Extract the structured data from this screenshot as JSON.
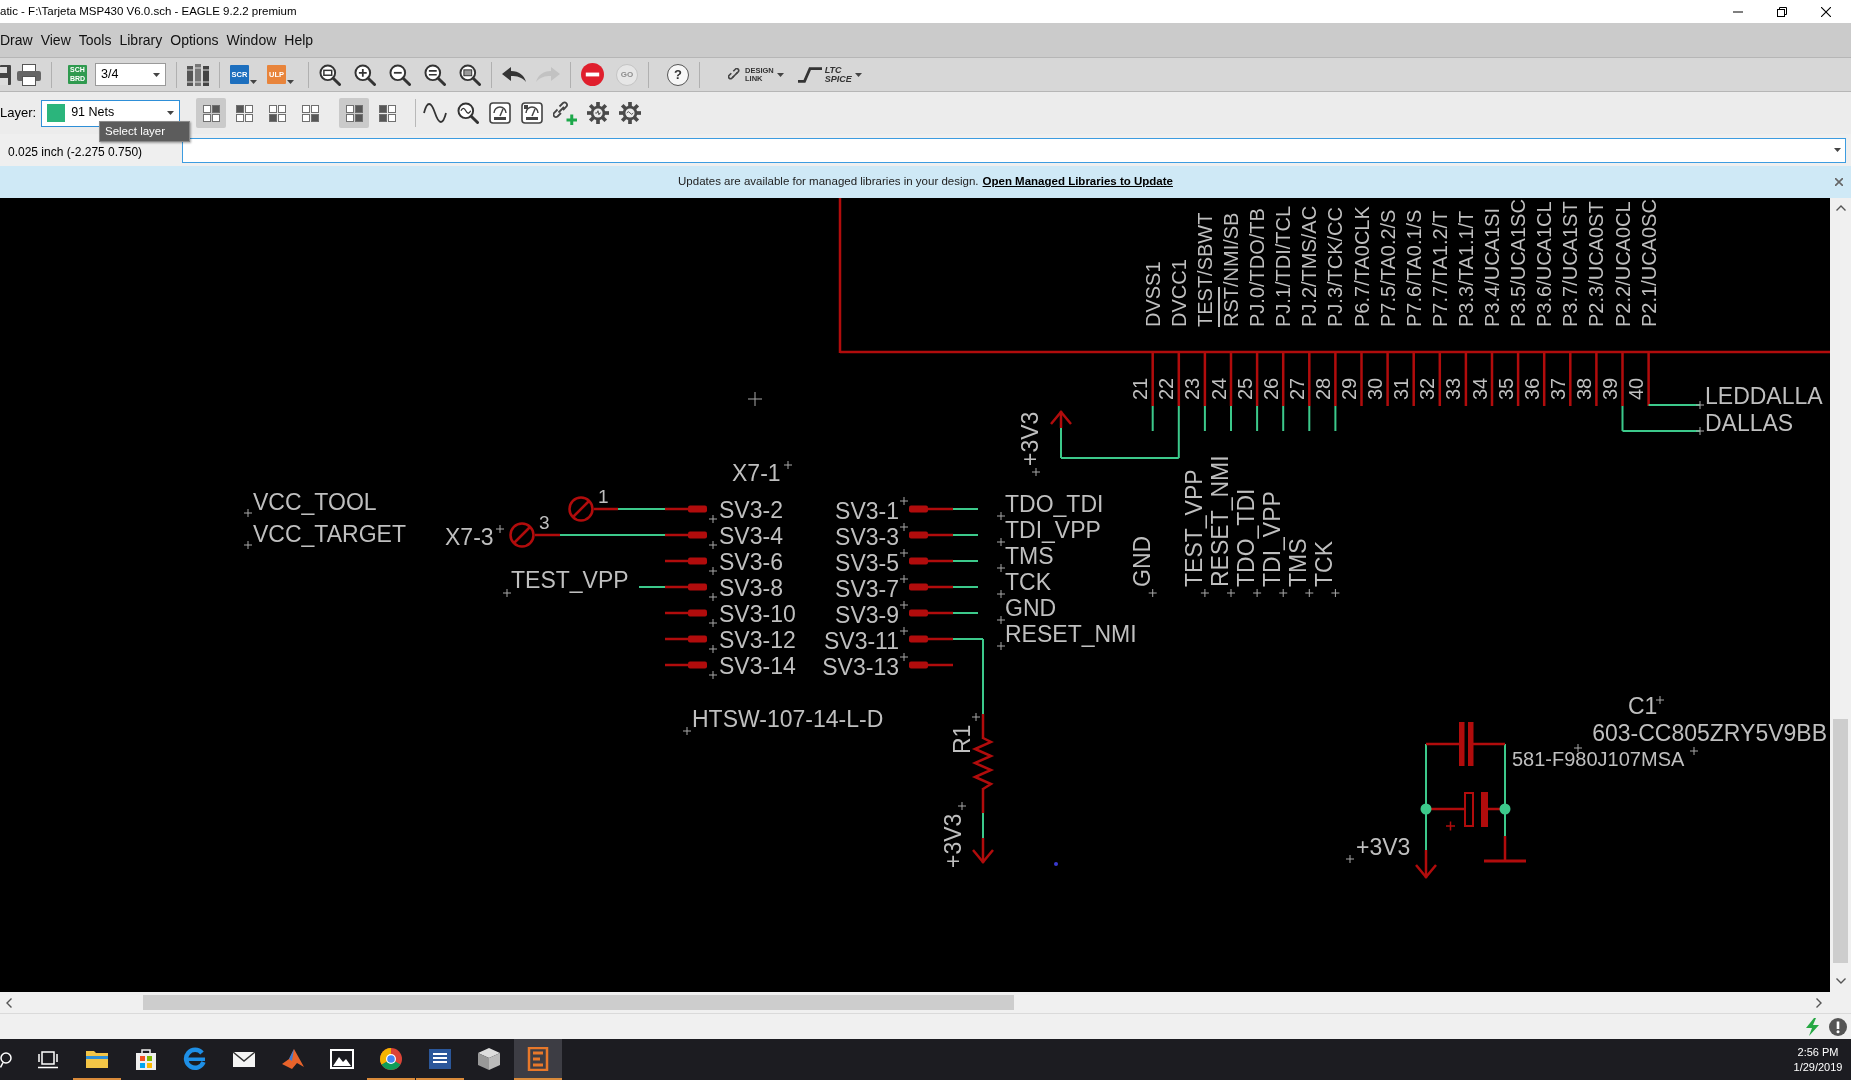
{
  "window": {
    "title": "atic - F:\\Tarjeta MSP430 V6.0.sch - EAGLE 9.2.2 premium"
  },
  "menu": [
    "Draw",
    "View",
    "Tools",
    "Library",
    "Options",
    "Window",
    "Help"
  ],
  "toolbar": {
    "sheet_button": {
      "lines": [
        "SCH",
        "BRD"
      ]
    },
    "sheet_select": {
      "value": "3/4"
    },
    "script_button": {
      "label": "SCR"
    },
    "ulp_button": {
      "label": "ULP"
    },
    "undo_button": {
      "disabled": false
    },
    "redo_button": {
      "disabled": true
    },
    "stop_button": {
      "disabled": false
    },
    "go_button": {
      "label": "GO",
      "disabled": true
    },
    "help_button": {
      "label": "?"
    },
    "design_link_button": {
      "lines": [
        "DESIGN",
        "LINK"
      ]
    },
    "spice_button": {
      "lines": [
        "LTC",
        "SPICE"
      ]
    }
  },
  "layer_toolbar": {
    "label": "Layer:",
    "layer_select": {
      "value": "91 Nets"
    },
    "tooltip": "Select layer",
    "view_modes_a": [
      {
        "selected": true
      },
      {
        "selected": false
      },
      {
        "selected": false
      },
      {
        "selected": false
      }
    ],
    "view_modes_b": [
      {
        "selected": true
      },
      {
        "selected": false
      }
    ]
  },
  "command_bar": {
    "coordinates": "0.025 inch (-2.275 0.750)"
  },
  "update_banner": {
    "message": "Updates are available for managed libraries in your design.",
    "link": "Open Managed Libraries to Update"
  },
  "schematic": {
    "chip": {
      "pins": [
        {
          "number": "21",
          "name": "DVSS1",
          "active_low": false
        },
        {
          "number": "22",
          "name": "DVCC1",
          "active_low": false
        },
        {
          "number": "23",
          "name": "TEST/SBWT",
          "active_low": false
        },
        {
          "number": "24",
          "name": "RST/NMI/SB",
          "active_low": true
        },
        {
          "number": "25",
          "name": "PJ.0/TDO/TB",
          "active_low": false
        },
        {
          "number": "26",
          "name": "PJ.1/TDI/TCL",
          "active_low": false
        },
        {
          "number": "27",
          "name": "PJ.2/TMS/AC",
          "active_low": false
        },
        {
          "number": "28",
          "name": "PJ.3/TCK/CC",
          "active_low": false
        },
        {
          "number": "29",
          "name": "P6.7/TA0CLK",
          "active_low": false
        },
        {
          "number": "30",
          "name": "P7.5/TA0.2/S",
          "active_low": false
        },
        {
          "number": "31",
          "name": "P7.6/TA0.1/S",
          "active_low": false
        },
        {
          "number": "32",
          "name": "P7.7/TA1.2/T",
          "active_low": false
        },
        {
          "number": "33",
          "name": "P3.3/TA1.1/T",
          "active_low": false
        },
        {
          "number": "34",
          "name": "P3.4/UCA1SI",
          "active_low": false
        },
        {
          "number": "35",
          "name": "P3.5/UCA1SC",
          "active_low": false
        },
        {
          "number": "36",
          "name": "P3.6/UCA1CL",
          "active_low": false
        },
        {
          "number": "37",
          "name": "P3.7/UCA1ST",
          "active_low": false
        },
        {
          "number": "38",
          "name": "P2.3/UCA0ST",
          "active_low": false
        },
        {
          "number": "39",
          "name": "P2.2/UCA0CL",
          "active_low": false
        },
        {
          "number": "40",
          "name": "P2.1/UCA0SC",
          "active_low": false
        }
      ]
    },
    "chip_nets": {
      "side": [
        "LEDDALLA",
        "DALLAS"
      ],
      "supply": "+3V3",
      "vertical": [
        "GND",
        "TEST_VPP",
        "RESET_NMI",
        "TDO_TDI",
        "TDI_VPP",
        "TMS",
        "TCK"
      ]
    },
    "jumper": {
      "labels": [
        "X7-1",
        "X7-3"
      ],
      "pin_numbers": [
        "1",
        "3"
      ]
    },
    "power_labels": [
      "VCC_TOOL",
      "VCC_TARGET"
    ],
    "header": {
      "left_pins": [
        "SV3-2",
        "SV3-4",
        "SV3-6",
        "SV3-8",
        "SV3-10",
        "SV3-12",
        "SV3-14"
      ],
      "right_pins": [
        "SV3-1",
        "SV3-3",
        "SV3-5",
        "SV3-7",
        "SV3-9",
        "SV3-11",
        "SV3-13"
      ],
      "left_nets": [
        "TEST_VPP"
      ],
      "right_nets": [
        "TDO_TDI",
        "TDI_VPP",
        "TMS",
        "TCK",
        "GND",
        "RESET_NMI"
      ],
      "value": "HTSW-107-14-L-D"
    },
    "resistor": {
      "name": "R1",
      "supply": "+3V3"
    },
    "capacitors": {
      "name": "C1",
      "values": [
        "603-CC805ZRY5V9BB",
        "581-F980J107MSA"
      ],
      "supply": "+3V3"
    }
  },
  "taskbar": {
    "apps": [
      {
        "kind": "folder",
        "running": true,
        "active": false
      },
      {
        "kind": "bag",
        "running": false,
        "active": false
      },
      {
        "kind": "swirl",
        "running": false,
        "active": false
      },
      {
        "kind": "envelope",
        "running": false,
        "active": false
      },
      {
        "kind": "peak",
        "running": false,
        "active": false
      },
      {
        "kind": "picture",
        "running": false,
        "active": false
      },
      {
        "kind": "ring",
        "running": true,
        "active": false
      },
      {
        "kind": "document",
        "running": true,
        "active": false
      },
      {
        "kind": "cube",
        "running": false,
        "active": false
      },
      {
        "kind": "tile",
        "running": true,
        "active": true
      }
    ],
    "time": "2:56 PM",
    "date": "1/29/2019"
  }
}
